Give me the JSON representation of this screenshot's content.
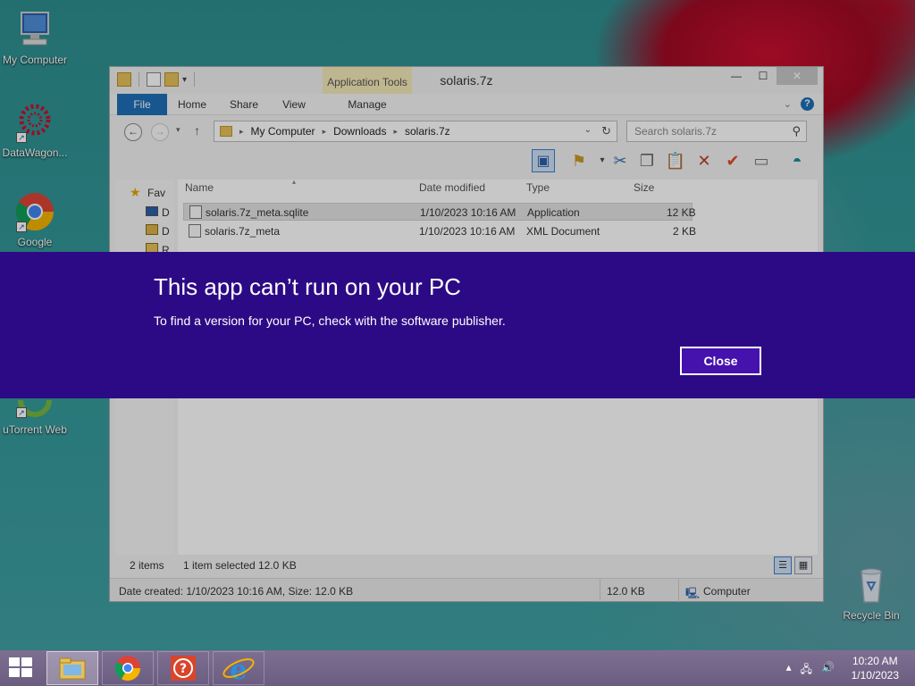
{
  "desktop": {
    "icons": [
      {
        "label": "My Computer"
      },
      {
        "label": "DataWagon..."
      },
      {
        "label": "Google"
      },
      {
        "label": "uTorrent Web"
      },
      {
        "label": "Recycle Bin"
      }
    ]
  },
  "explorer": {
    "title": "solaris.7z",
    "context_tab": "Application Tools",
    "tabs": {
      "file": "File",
      "home": "Home",
      "share": "Share",
      "view": "View",
      "manage": "Manage"
    },
    "address": {
      "crumbs": [
        "My Computer",
        "Downloads",
        "solaris.7z"
      ]
    },
    "search_placeholder": "Search solaris.7z",
    "nav_pane": {
      "favorites": "Fav",
      "item2": "D",
      "item3": "D",
      "item4": "R"
    },
    "columns": {
      "name": "Name",
      "date": "Date modified",
      "type": "Type",
      "size": "Size"
    },
    "files": [
      {
        "name": "solaris.7z_meta.sqlite",
        "date": "1/10/2023 10:16 AM",
        "type": "Application",
        "size": "12 KB",
        "selected": true
      },
      {
        "name": "solaris.7z_meta",
        "date": "1/10/2023 10:16 AM",
        "type": "XML Document",
        "size": "2 KB",
        "selected": false
      }
    ],
    "status": {
      "items": "2 items",
      "selected": "1 item selected",
      "selected_size": "12.0 KB"
    },
    "details": {
      "created": "Date created: 1/10/2023 10:16 AM, Size: 12.0 KB",
      "size": "12.0 KB",
      "location": "Computer"
    }
  },
  "banner": {
    "title": "This app can’t run on your PC",
    "message": "To find a version for your PC, check with the software publisher.",
    "close_label": "Close",
    "color": "#2d0a85"
  },
  "taskbar": {
    "pinned": [
      "file-explorer-icon",
      "chrome-icon",
      "help-icon",
      "internet-explorer-icon"
    ],
    "clock": {
      "time": "10:20 AM",
      "date": "1/10/2023"
    }
  }
}
